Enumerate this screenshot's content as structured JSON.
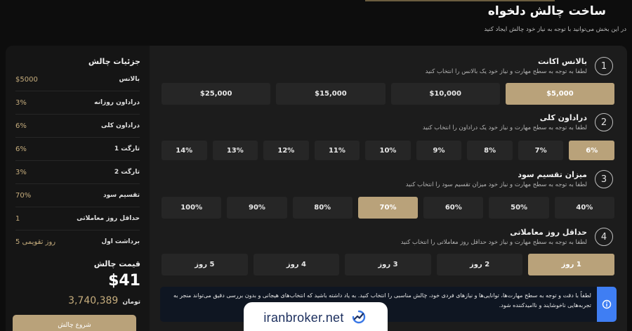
{
  "page": {
    "title": "ساخت چالش دلخواه",
    "subtitle": "در این بخش می‌توانید با توجه به نیاز خود چالش ایجاد کنید"
  },
  "sidebar": {
    "title": "جزئیات چالش",
    "rows": [
      {
        "label": "بالانس",
        "value": "$5000"
      },
      {
        "label": "دراداون روزانه",
        "value": "3%"
      },
      {
        "label": "دراداون کلی",
        "value": "6%"
      },
      {
        "label": "تارگت 1",
        "value": "6%"
      },
      {
        "label": "تارگت 2",
        "value": "3%"
      },
      {
        "label": "تقسیم سود",
        "value": "70%"
      },
      {
        "label": "حداقل روز معاملاتی",
        "value": "1"
      },
      {
        "label": "برداشت اول",
        "value": "5 روز تقویمی"
      }
    ],
    "price_label": "قیمت چالش",
    "price_usd": "$41",
    "price_toman": "3,740,389",
    "toman_unit": "تومان",
    "start_button": "شروع چالش"
  },
  "steps": [
    {
      "num": "1",
      "title": "بالانس اکانت",
      "desc": "لطفا به توجه به سطح مهارت و نیاز خود یک بالانس را انتخاب کنید",
      "options": [
        "$5,000",
        "$10,000",
        "$15,000",
        "$25,000"
      ],
      "selected": "$5,000"
    },
    {
      "num": "2",
      "title": "دراداون کلی",
      "desc": "لطفا به توجه به سطح مهارت و نیاز خود یک دراداون را انتخاب کنید",
      "options": [
        "6%",
        "7%",
        "8%",
        "9%",
        "10%",
        "11%",
        "12%",
        "13%",
        "14%"
      ],
      "selected": "6%"
    },
    {
      "num": "3",
      "title": "میزان تقسیم سود",
      "desc": "لطفا به توجه به سطح مهارت و نیاز خود میزان تقسیم سود را انتخاب کنید",
      "options": [
        "40%",
        "50%",
        "60%",
        "70%",
        "80%",
        "90%",
        "100%"
      ],
      "selected": "70%"
    },
    {
      "num": "4",
      "title": "حداقل روز معاملاتی",
      "desc": "لطفا به توجه به سطح مهارت و نیاز خود حداقل روز معاملاتی را انتخاب کنید",
      "options": [
        "1 روز",
        "2 روز",
        "3 روز",
        "4 روز",
        "5 روز"
      ],
      "selected": "1 روز"
    }
  ],
  "notice": {
    "text": "لطفاً با دقت و توجه به سطح مهارت‌ها، توانایی‌ها و نیازهای فردی خود، چالش مناسبی را انتخاب کنید. به یاد داشته باشید که انتخاب‌های هیجانی و بدون بررسی دقیق می‌تواند منجر به تجربه‌هایی ناخوشایند و ناامیدکننده شود.",
    "icon": "info-icon"
  },
  "watermark": {
    "text": "iranbroker.net"
  },
  "colors": {
    "accent": "#b9a27a",
    "info": "#3f7ef3",
    "panel": "#1c1c1c",
    "option": "#262626"
  }
}
